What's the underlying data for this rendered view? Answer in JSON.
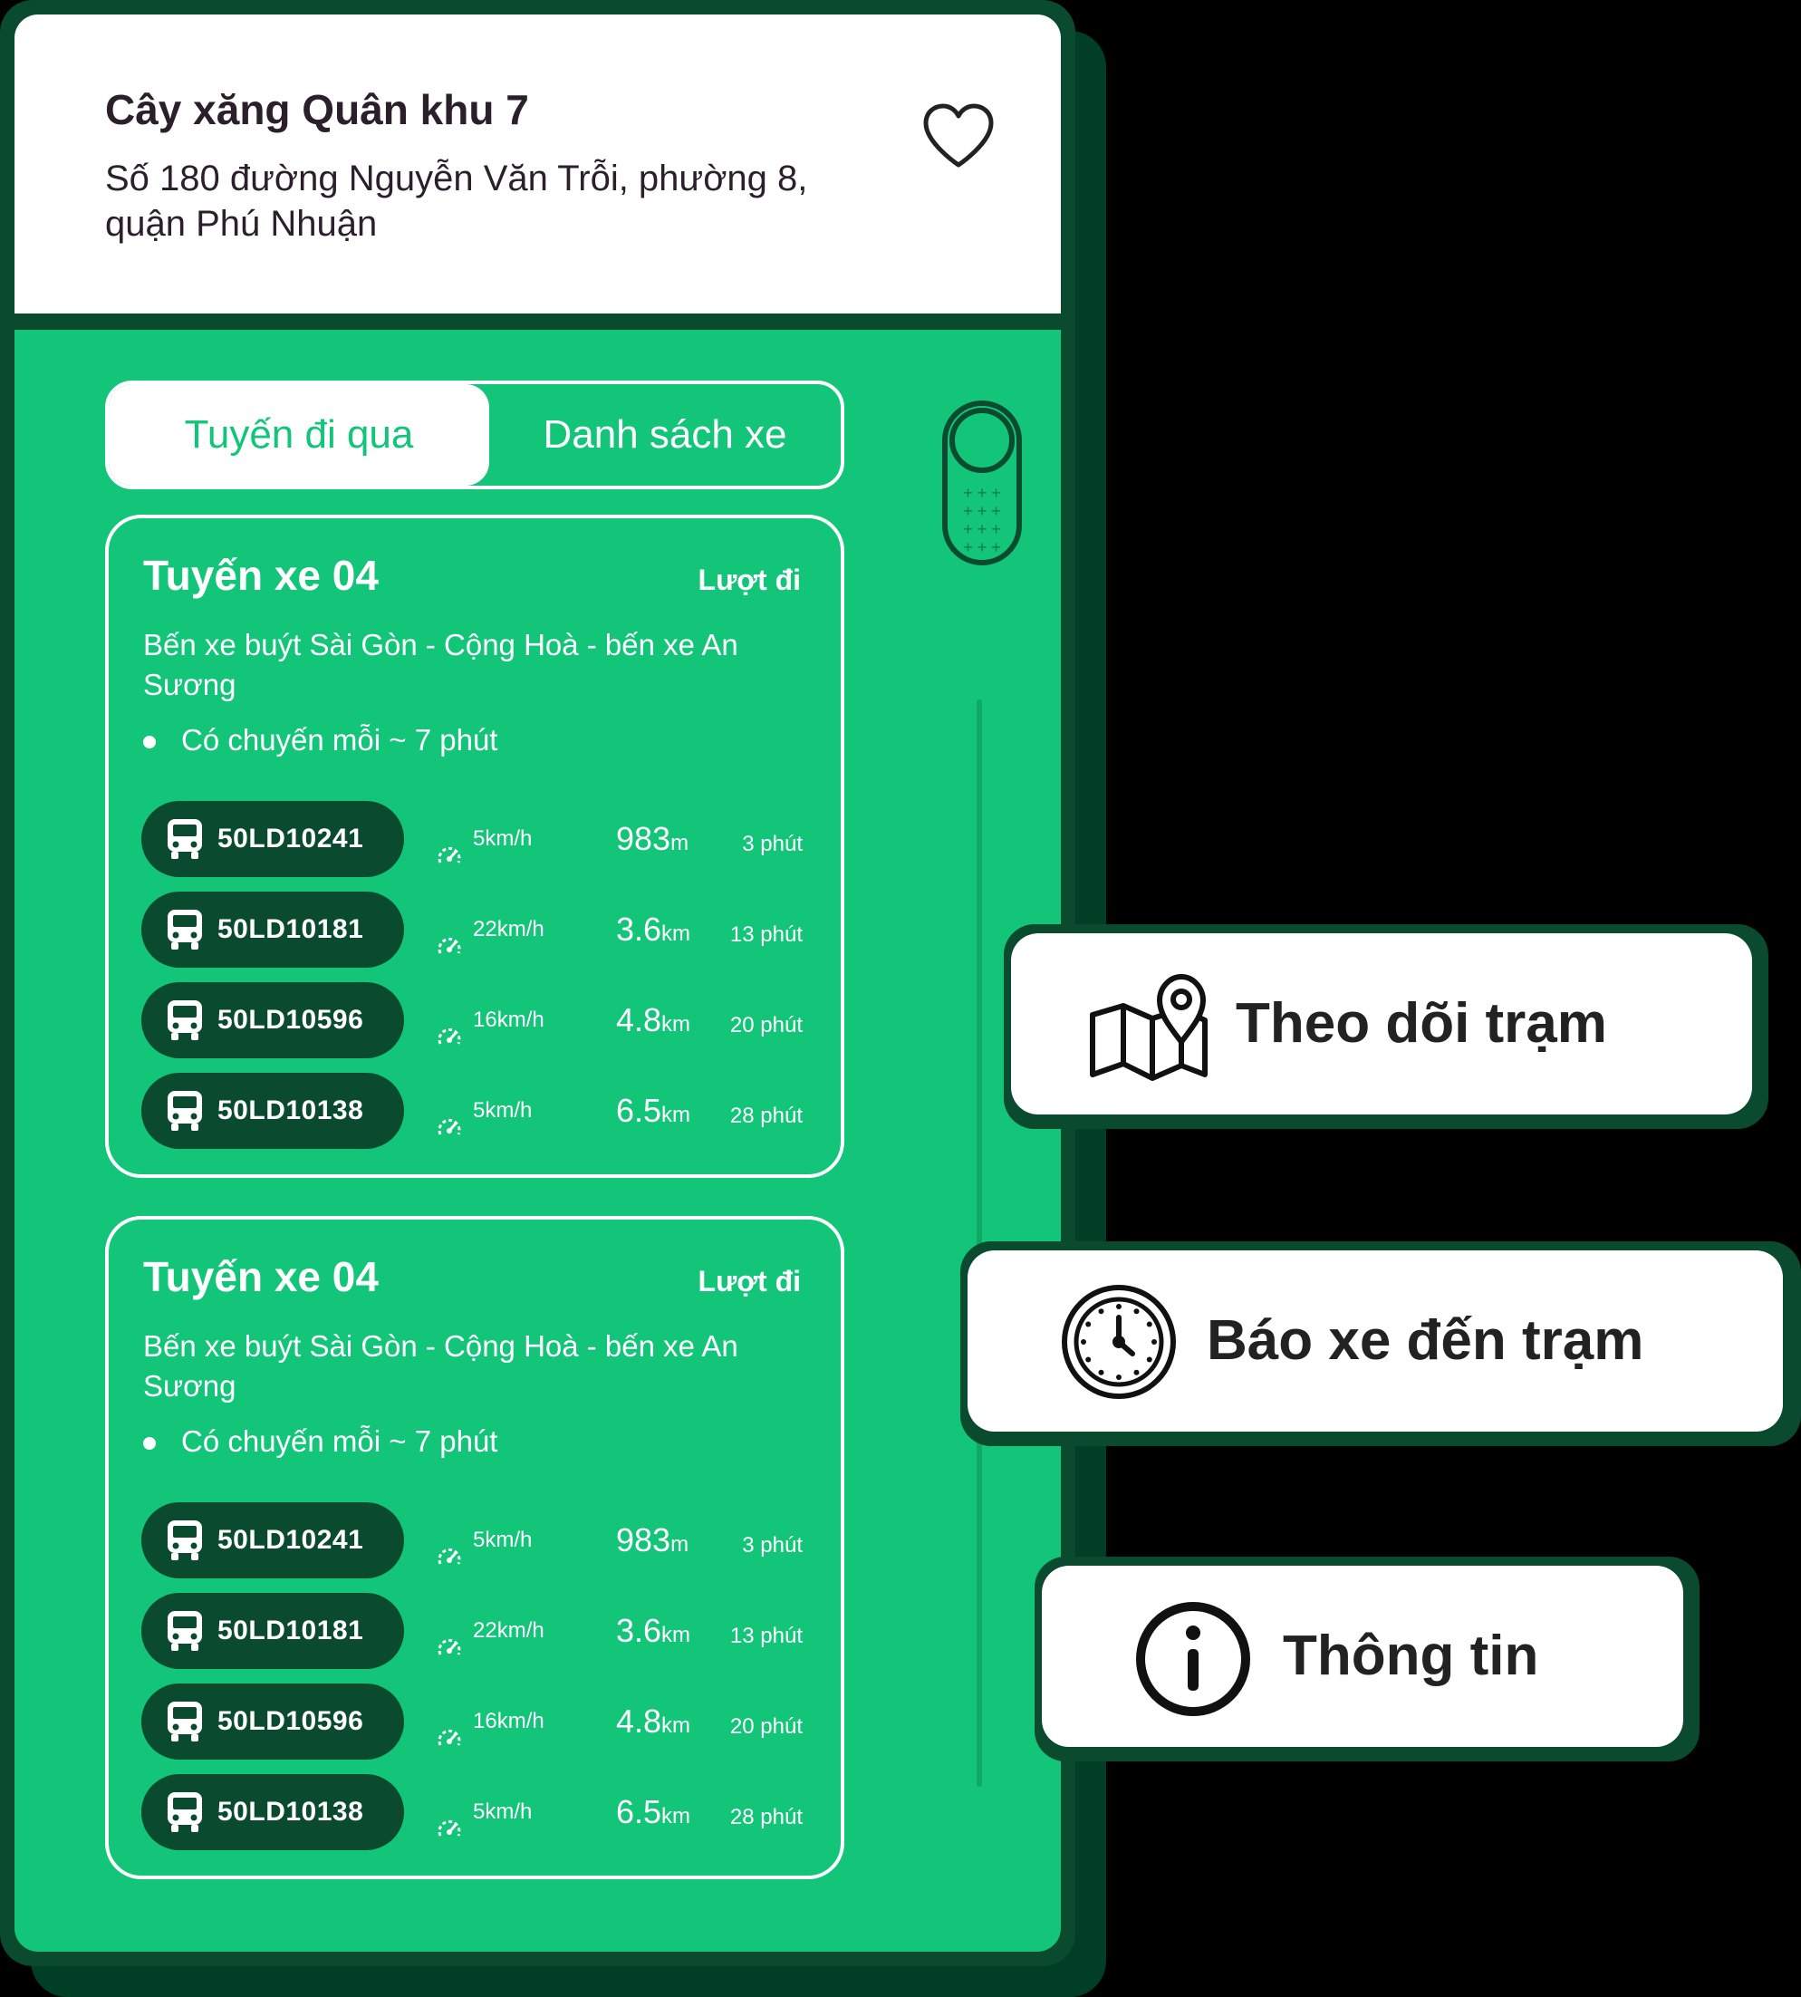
{
  "station": {
    "name": "Cây xăng Quân khu 7",
    "address": "Số 180 đường Nguyễn Văn Trỗi, phường 8, quận Phú Nhuận"
  },
  "tabs": {
    "active": "Tuyến đi qua",
    "inactive": "Danh sách xe"
  },
  "routes": [
    {
      "title": "Tuyến xe 04",
      "direction": "Lượt đi",
      "description": "Bến xe buýt Sài Gòn - Cộng Hoà - bến xe An Sương",
      "frequency": "Có chuyến mỗi ~ 7 phút",
      "buses": [
        {
          "plate": "50LD10241",
          "speed": "5km/h",
          "dist": "983",
          "unit": "m",
          "eta": "3 phút"
        },
        {
          "plate": "50LD10181",
          "speed": "22km/h",
          "dist": "3.6",
          "unit": "km",
          "eta": "13 phút"
        },
        {
          "plate": "50LD10596",
          "speed": "16km/h",
          "dist": "4.8",
          "unit": "km",
          "eta": "20 phút"
        },
        {
          "plate": "50LD10138",
          "speed": "5km/h",
          "dist": "6.5",
          "unit": "km",
          "eta": "28 phút"
        }
      ]
    },
    {
      "title": "Tuyến xe 04",
      "direction": "Lượt đi",
      "description": "Bến xe buýt Sài Gòn - Cộng Hoà - bến xe An Sương",
      "frequency": "Có chuyến mỗi ~ 7 phút",
      "buses": [
        {
          "plate": "50LD10241",
          "speed": "5km/h",
          "dist": "983",
          "unit": "m",
          "eta": "3 phút"
        },
        {
          "plate": "50LD10181",
          "speed": "22km/h",
          "dist": "3.6",
          "unit": "km",
          "eta": "13 phút"
        },
        {
          "plate": "50LD10596",
          "speed": "16km/h",
          "dist": "4.8",
          "unit": "km",
          "eta": "20 phút"
        },
        {
          "plate": "50LD10138",
          "speed": "5km/h",
          "dist": "6.5",
          "unit": "km",
          "eta": "28 phút"
        }
      ]
    }
  ],
  "actions": {
    "follow": "Theo dõi trạm",
    "notify": "Báo xe đến trạm",
    "info": "Thông tin"
  },
  "colors": {
    "primary_green": "#12c578",
    "dark_green": "#0a4a2f",
    "text_dark": "#2a1f2b"
  },
  "icons": {
    "heart": "heart-icon",
    "bus": "bus-icon",
    "speed": "speedometer-icon",
    "map": "map-pin-icon",
    "clock": "clock-icon",
    "info": "info-icon"
  }
}
